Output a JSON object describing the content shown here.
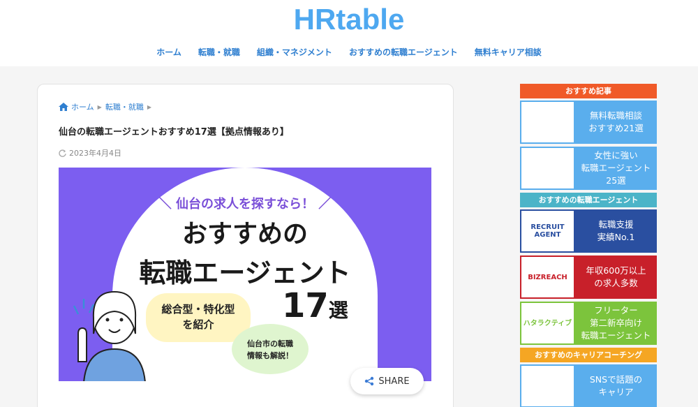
{
  "site": {
    "logo": "HRtable"
  },
  "nav": [
    "ホーム",
    "転職・就職",
    "組織・マネジメント",
    "おすすめの転職エージェント",
    "無料キャリア相談"
  ],
  "breadcrumb": {
    "home": "ホーム",
    "category": "転職・就職"
  },
  "article": {
    "title": "仙台の転職エージェントおすすめ17選【拠点情報あり】",
    "date": "2023年4月4日"
  },
  "banner": {
    "sub": "＼ 仙台の求人を探すなら！ ／",
    "line1": "おすすめの",
    "line2": "転職エージェント",
    "bubble_yellow_1": "総合型・特化型",
    "bubble_yellow_2": "を紹介",
    "bubble_green_1": "仙台市の転職",
    "bubble_green_2": "情報も解説！",
    "count": "17",
    "count_suffix": "選"
  },
  "share": {
    "label": "SHARE"
  },
  "sidebar": {
    "sections": [
      {
        "heading": "おすすめ記事",
        "color": "#f05a28",
        "items": [
          {
            "text": "無料転職相談\nおすすめ21選",
            "color": "#5aaeed"
          },
          {
            "text": "女性に強い\n転職エージェント\n25選",
            "color": "#5aaeed"
          }
        ]
      },
      {
        "heading": "おすすめの転職エージェント",
        "color": "#4bb4c8",
        "items": [
          {
            "text": "転職支援\n実績No.1",
            "color": "#2a4fa0",
            "thumb": "RECRUIT\nAGENT"
          },
          {
            "text": "年収600万以上\nの求人多数",
            "color": "#c8202a",
            "thumb": "BIZREACH"
          },
          {
            "text": "フリーター\n第二新卒向け\n転職エージェント",
            "color": "#7cc43c",
            "thumb": "ハタラクティブ"
          }
        ]
      },
      {
        "heading": "おすすめのキャリアコーチング",
        "color": "#f5a623",
        "items": [
          {
            "text": "SNSで話題の\nキャリア",
            "color": "#5aaeed"
          }
        ]
      }
    ]
  }
}
